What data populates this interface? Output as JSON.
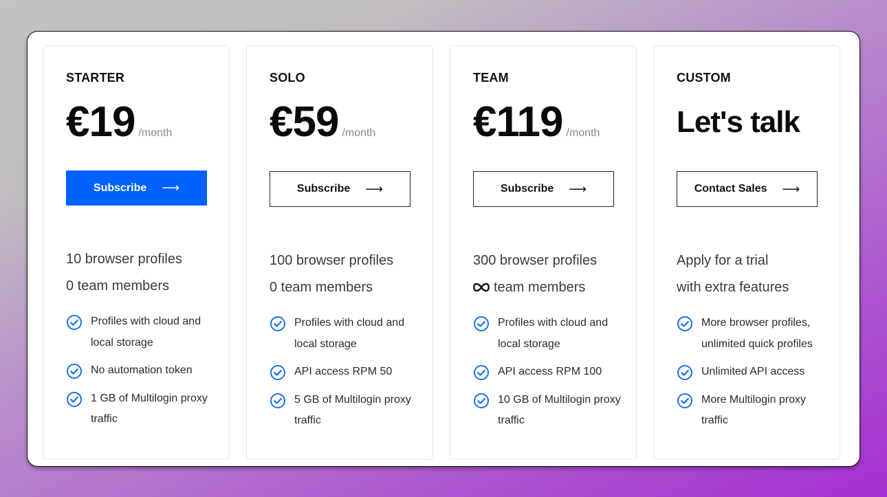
{
  "plans": [
    {
      "name": "STARTER",
      "price": "€19",
      "period": "/month",
      "cta_label": "Subscribe",
      "cta_style": "primary",
      "profiles": "10 browser profiles",
      "members": "0 team members",
      "features": [
        "Profiles with cloud and local storage",
        "No automation token",
        "1 GB of Multilogin proxy traffic"
      ]
    },
    {
      "name": "SOLO",
      "price": "€59",
      "period": "/month",
      "cta_label": "Subscribe",
      "cta_style": "outline",
      "profiles": "100 browser profiles",
      "members": "0 team members",
      "features": [
        "Profiles with cloud and local storage",
        "API access RPM 50",
        "5 GB of Multilogin proxy traffic"
      ]
    },
    {
      "name": "TEAM",
      "price": "€119",
      "period": "/month",
      "cta_label": "Subscribe",
      "cta_style": "outline",
      "profiles": "300 browser profiles",
      "members": "team members",
      "members_icon": "infinity-icon",
      "features": [
        "Profiles with cloud and local storage",
        "API access RPM 100",
        "10 GB of Multilogin proxy traffic"
      ]
    },
    {
      "name": "CUSTOM",
      "headline": "Let's talk",
      "cta_label": "Contact Sales",
      "cta_style": "outline",
      "profiles": "Apply for a trial",
      "members": "with extra features",
      "features": [
        "More browser profiles, unlimited quick profiles",
        "Unlimited API access",
        "More Multilogin proxy traffic"
      ]
    }
  ],
  "icons": {
    "cta_arrow": "arrow-right-icon",
    "feature_check": "check-circle-icon"
  },
  "colors": {
    "accent": "#0061ff",
    "check": "#1a6fe8"
  }
}
